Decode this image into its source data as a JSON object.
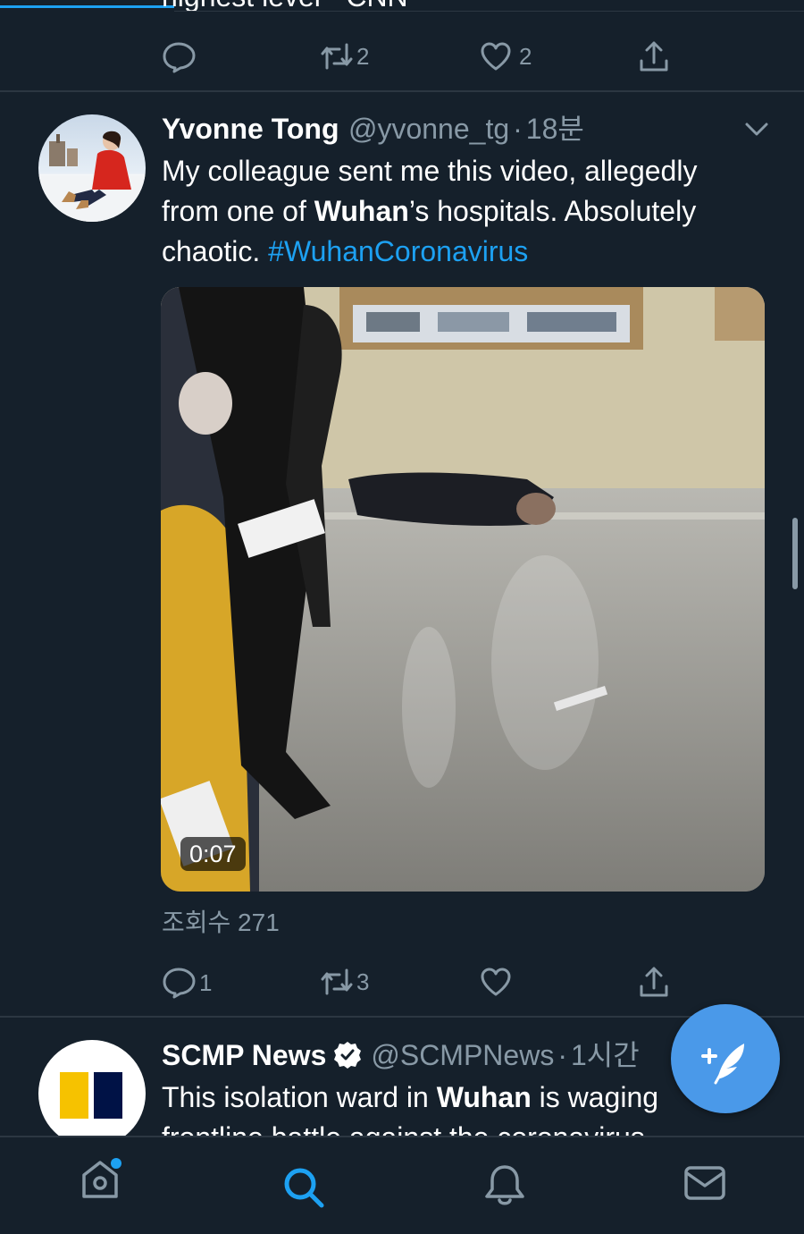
{
  "prev_tweet": {
    "text_fragment": "highest level - CNN",
    "retweet_count": "2",
    "like_count": "2"
  },
  "tweet1": {
    "name": "Yvonne Tong",
    "handle": "@yvonne_tg",
    "dot": "·",
    "time": "18분",
    "text": {
      "line1": "My colleague sent me this video, allegedly",
      "line2_pre": "from one of ",
      "line2_bold": "Wuhan",
      "line2_post": "’s hospitals. Absolutely",
      "line3_pre": "chaotic. ",
      "hashtag": "#WuhanCoronavirus"
    },
    "video_duration": "0:07",
    "views": "조회수 271",
    "reply_count": "1",
    "retweet_count": "3",
    "like_count": ""
  },
  "tweet2": {
    "name": "SCMP News",
    "handle": "@SCMPNews",
    "dot": "·",
    "time": "1시간",
    "text": {
      "line1_pre": "This isolation ward in ",
      "line1_bold": "Wuhan",
      "line1_post": " is waging",
      "line2": "frontline battle against the coronavirus"
    }
  },
  "colors": {
    "background": "#15202b",
    "accent": "#1da1f2",
    "fab": "#4a99e9",
    "muted": "#8899a6",
    "divider": "#2c3742"
  },
  "icons": {
    "home": "home-icon",
    "search": "search-icon",
    "notifications": "bell-icon",
    "messages": "mail-icon",
    "compose": "compose-feather-icon",
    "verified": "verified-badge-icon",
    "chevron": "chevron-down-icon"
  }
}
